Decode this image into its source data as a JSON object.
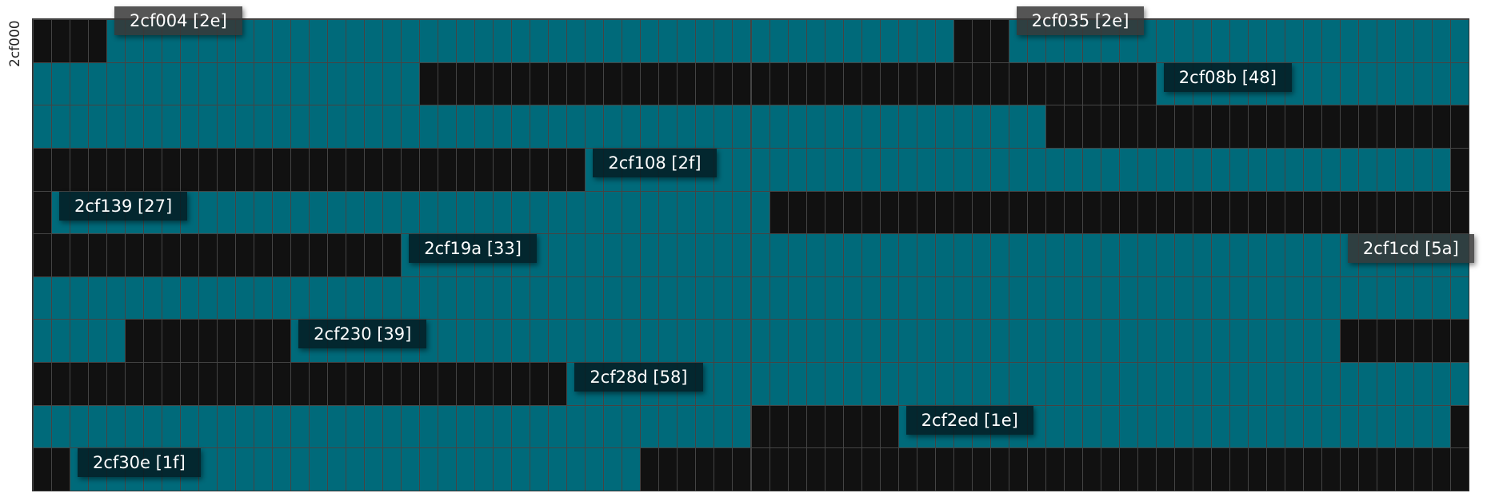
{
  "axis_label": "2cf000",
  "colors": {
    "allocated": "#111111",
    "free": "#006a7a",
    "grid_line": "#444444"
  },
  "grid": {
    "columns": 78,
    "rows": [
      [
        [
          0,
          4,
          "allocated"
        ],
        [
          4,
          50,
          "free"
        ],
        [
          50,
          53,
          "allocated"
        ],
        [
          53,
          78,
          "free"
        ]
      ],
      [
        [
          0,
          21,
          "free"
        ],
        [
          21,
          61,
          "allocated"
        ],
        [
          61,
          78,
          "free"
        ]
      ],
      [
        [
          0,
          55,
          "free"
        ],
        [
          55,
          78,
          "allocated"
        ]
      ],
      [
        [
          0,
          30,
          "allocated"
        ],
        [
          30,
          77,
          "free"
        ],
        [
          77,
          78,
          "allocated"
        ]
      ],
      [
        [
          0,
          1,
          "allocated"
        ],
        [
          1,
          40,
          "free"
        ],
        [
          40,
          78,
          "allocated"
        ]
      ],
      [
        [
          0,
          20,
          "allocated"
        ],
        [
          20,
          78,
          "free"
        ]
      ],
      [
        [
          0,
          78,
          "free"
        ]
      ],
      [
        [
          0,
          5,
          "free"
        ],
        [
          5,
          14,
          "allocated"
        ],
        [
          14,
          71,
          "free"
        ],
        [
          71,
          78,
          "allocated"
        ]
      ],
      [
        [
          0,
          29,
          "allocated"
        ],
        [
          29,
          78,
          "free"
        ]
      ],
      [
        [
          0,
          39,
          "free"
        ],
        [
          39,
          47,
          "allocated"
        ],
        [
          47,
          77,
          "free"
        ],
        [
          77,
          78,
          "allocated"
        ]
      ],
      [
        [
          0,
          2,
          "allocated"
        ],
        [
          2,
          33,
          "free"
        ],
        [
          33,
          78,
          "allocated"
        ]
      ]
    ]
  },
  "blocks": [
    {
      "label": "2cf004  [2e]",
      "row": 0,
      "col": 4,
      "style": "hi"
    },
    {
      "label": "2cf035  [2e]",
      "row": 0,
      "col": 53,
      "style": "hi"
    },
    {
      "label": "2cf08b  [48]",
      "row": 1,
      "col": 61,
      "style": "dark"
    },
    {
      "label": "2cf108  [2f]",
      "row": 3,
      "col": 30,
      "style": "dark"
    },
    {
      "label": "2cf139  [27]",
      "row": 4,
      "col": 1,
      "style": "dark"
    },
    {
      "label": "2cf19a  [33]",
      "row": 5,
      "col": 20,
      "style": "dark"
    },
    {
      "label": "2cf1cd  [5a]",
      "row": 5,
      "col": 71,
      "style": "hi"
    },
    {
      "label": "2cf230  [39]",
      "row": 7,
      "col": 14,
      "style": "dark"
    },
    {
      "label": "2cf28d  [58]",
      "row": 8,
      "col": 29,
      "style": "dark"
    },
    {
      "label": "2cf2ed  [1e]",
      "row": 9,
      "col": 47,
      "style": "dark"
    },
    {
      "label": "2cf30e  [1f]",
      "row": 10,
      "col": 2,
      "style": "dark"
    }
  ]
}
